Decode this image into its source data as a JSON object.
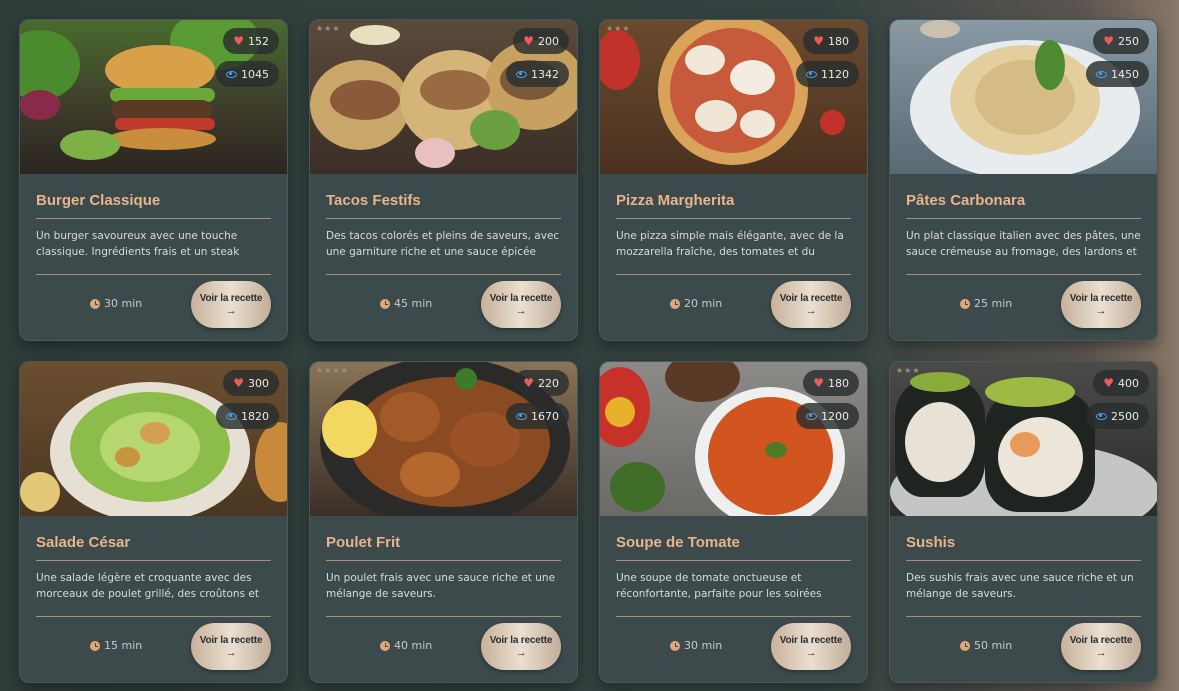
{
  "colors": {
    "accent_title": "#e8b48c",
    "card_bg": "#3c4a4b",
    "heart": "#ef5a5a",
    "eye": "#4aa0f0"
  },
  "recipes": [
    {
      "title": "Burger Classique",
      "description": "Un burger savoureux avec une touche classique. Ingrédients frais et un steak juteux...",
      "likes": "152",
      "views": "1045",
      "time": "30 min",
      "button": "Voir la recette",
      "arrow": "→",
      "stars": "",
      "image": "burger"
    },
    {
      "title": "Tacos Festifs",
      "description": "Des tacos colorés et pleins de saveurs, avec une garniture riche et une sauce épicée maison.",
      "likes": "200",
      "views": "1342",
      "time": "45 min",
      "button": "Voir la recette",
      "arrow": "→",
      "stars": "★★★",
      "image": "tacos"
    },
    {
      "title": "Pizza Margherita",
      "description": "Une pizza simple mais élégante, avec de la mozzarella fraîche, des tomates et du basilic.",
      "likes": "180",
      "views": "1120",
      "time": "20 min",
      "button": "Voir la recette",
      "arrow": "→",
      "stars": "★★★",
      "image": "pizza"
    },
    {
      "title": "Pâtes Carbonara",
      "description": "Un plat classique italien avec des pâtes, une sauce crémeuse au fromage, des lardons et d...",
      "likes": "250",
      "views": "1450",
      "time": "25 min",
      "button": "Voir la recette",
      "arrow": "→",
      "stars": "★★★",
      "image": "pasta"
    },
    {
      "title": "Salade César",
      "description": "Une salade légère et croquante avec des morceaux de poulet grillé, des croûtons et un...",
      "likes": "300",
      "views": "1820",
      "time": "15 min",
      "button": "Voir la recette",
      "arrow": "→",
      "stars": "",
      "image": "salad"
    },
    {
      "title": "Poulet Frit",
      "description": "Un poulet frais avec une sauce riche et une mélange de saveurs.",
      "likes": "220",
      "views": "1670",
      "time": "40 min",
      "button": "Voir la recette",
      "arrow": "→",
      "stars": "★★★★",
      "image": "chicken"
    },
    {
      "title": "Soupe de Tomate",
      "description": "Une soupe de tomate onctueuse et réconfortante, parfaite pour les soirées froides.",
      "likes": "180",
      "views": "1200",
      "time": "30 min",
      "button": "Voir la recette",
      "arrow": "→",
      "stars": "",
      "image": "soup"
    },
    {
      "title": "Sushis",
      "description": "Des sushis frais avec une sauce riche et un mélange de saveurs.",
      "likes": "400",
      "views": "2500",
      "time": "50 min",
      "button": "Voir la recette",
      "arrow": "→",
      "stars": "★★★",
      "image": "sushi"
    }
  ]
}
